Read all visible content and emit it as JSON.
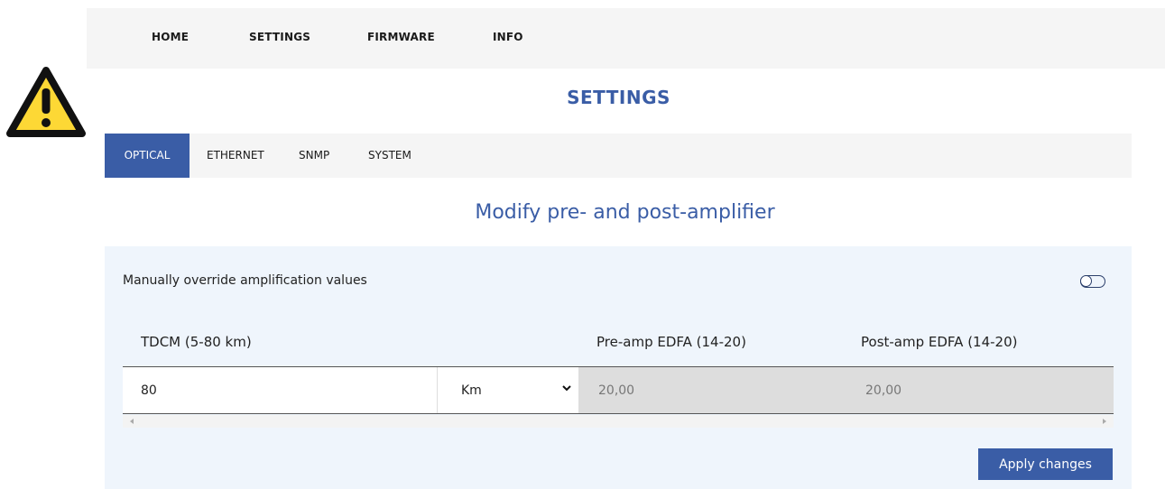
{
  "nav": {
    "items": [
      {
        "label": "HOME"
      },
      {
        "label": "SETTINGS"
      },
      {
        "label": "FIRMWARE"
      },
      {
        "label": "INFO"
      }
    ]
  },
  "page": {
    "title": "SETTINGS"
  },
  "tabs": {
    "items": [
      {
        "label": "OPTICAL",
        "active": true
      },
      {
        "label": "ETHERNET"
      },
      {
        "label": "SNMP"
      },
      {
        "label": "SYSTEM"
      }
    ]
  },
  "section": {
    "title": "Modify pre- and post-amplifier"
  },
  "panel": {
    "override_label": "Manually override amplification values",
    "override_enabled": false,
    "columns": {
      "tdcm": "TDCM (5-80 km)",
      "pre_amp": "Pre-amp EDFA (14-20)",
      "post_amp": "Post-amp EDFA (14-20)"
    },
    "row": {
      "tdcm_value": "80",
      "unit_selected": "Km",
      "pre_amp_value": "20,00",
      "post_amp_value": "20,00"
    },
    "apply_label": "Apply changes"
  },
  "colors": {
    "accent": "#3a5da6",
    "warning_yellow": "#fdd835",
    "panel_bg": "#eff5fc"
  },
  "icons": {
    "warning": "warning-triangle-icon",
    "dropdown": "chevron-down-icon"
  }
}
